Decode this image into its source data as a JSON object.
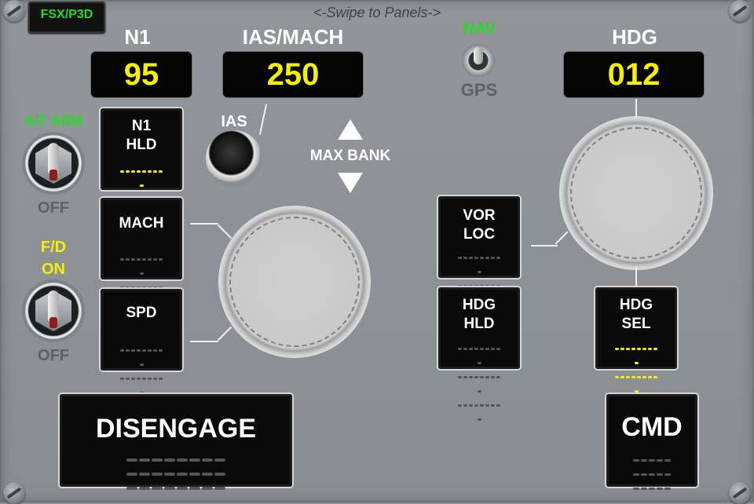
{
  "top": {
    "sim_button": "FSX/P3D",
    "swipe_hint": "<-Swipe to Panels->"
  },
  "n1": {
    "label": "N1",
    "value": "95"
  },
  "ias_mach": {
    "label": "IAS/MACH",
    "value": "250",
    "ias_button": "IAS"
  },
  "nav_gps": {
    "nav_label": "NAV",
    "gps_label": "GPS"
  },
  "hdg": {
    "label": "HDG",
    "value": "012"
  },
  "at_arm": {
    "label": "A/T ARM",
    "off_label": "OFF"
  },
  "fd": {
    "label_line1": "F/D",
    "label_line2": "ON",
    "off_label": "OFF"
  },
  "buttons": {
    "n1_hld": {
      "line1": "N1",
      "line2": "HLD",
      "lit": true
    },
    "mach": {
      "line1": "MACH",
      "lit": false
    },
    "spd": {
      "line1": "SPD",
      "lit": false
    },
    "vor_loc": {
      "line1": "VOR",
      "line2": "LOC",
      "lit": false
    },
    "hdg_hld": {
      "line1": "HDG",
      "line2": "HLD",
      "lit": false
    },
    "hdg_sel": {
      "line1": "HDG",
      "line2": "SEL",
      "lit": true
    },
    "disengage": {
      "label": "DISENGAGE"
    },
    "cmd": {
      "label": "CMD"
    }
  },
  "max_bank": {
    "label": "MAX BANK"
  },
  "colors": {
    "display_text": "#f4f000",
    "green_label": "#22dd22",
    "yellow_label": "#f4f000",
    "off_label": "#5d6064",
    "panel": "#8c8f93"
  }
}
